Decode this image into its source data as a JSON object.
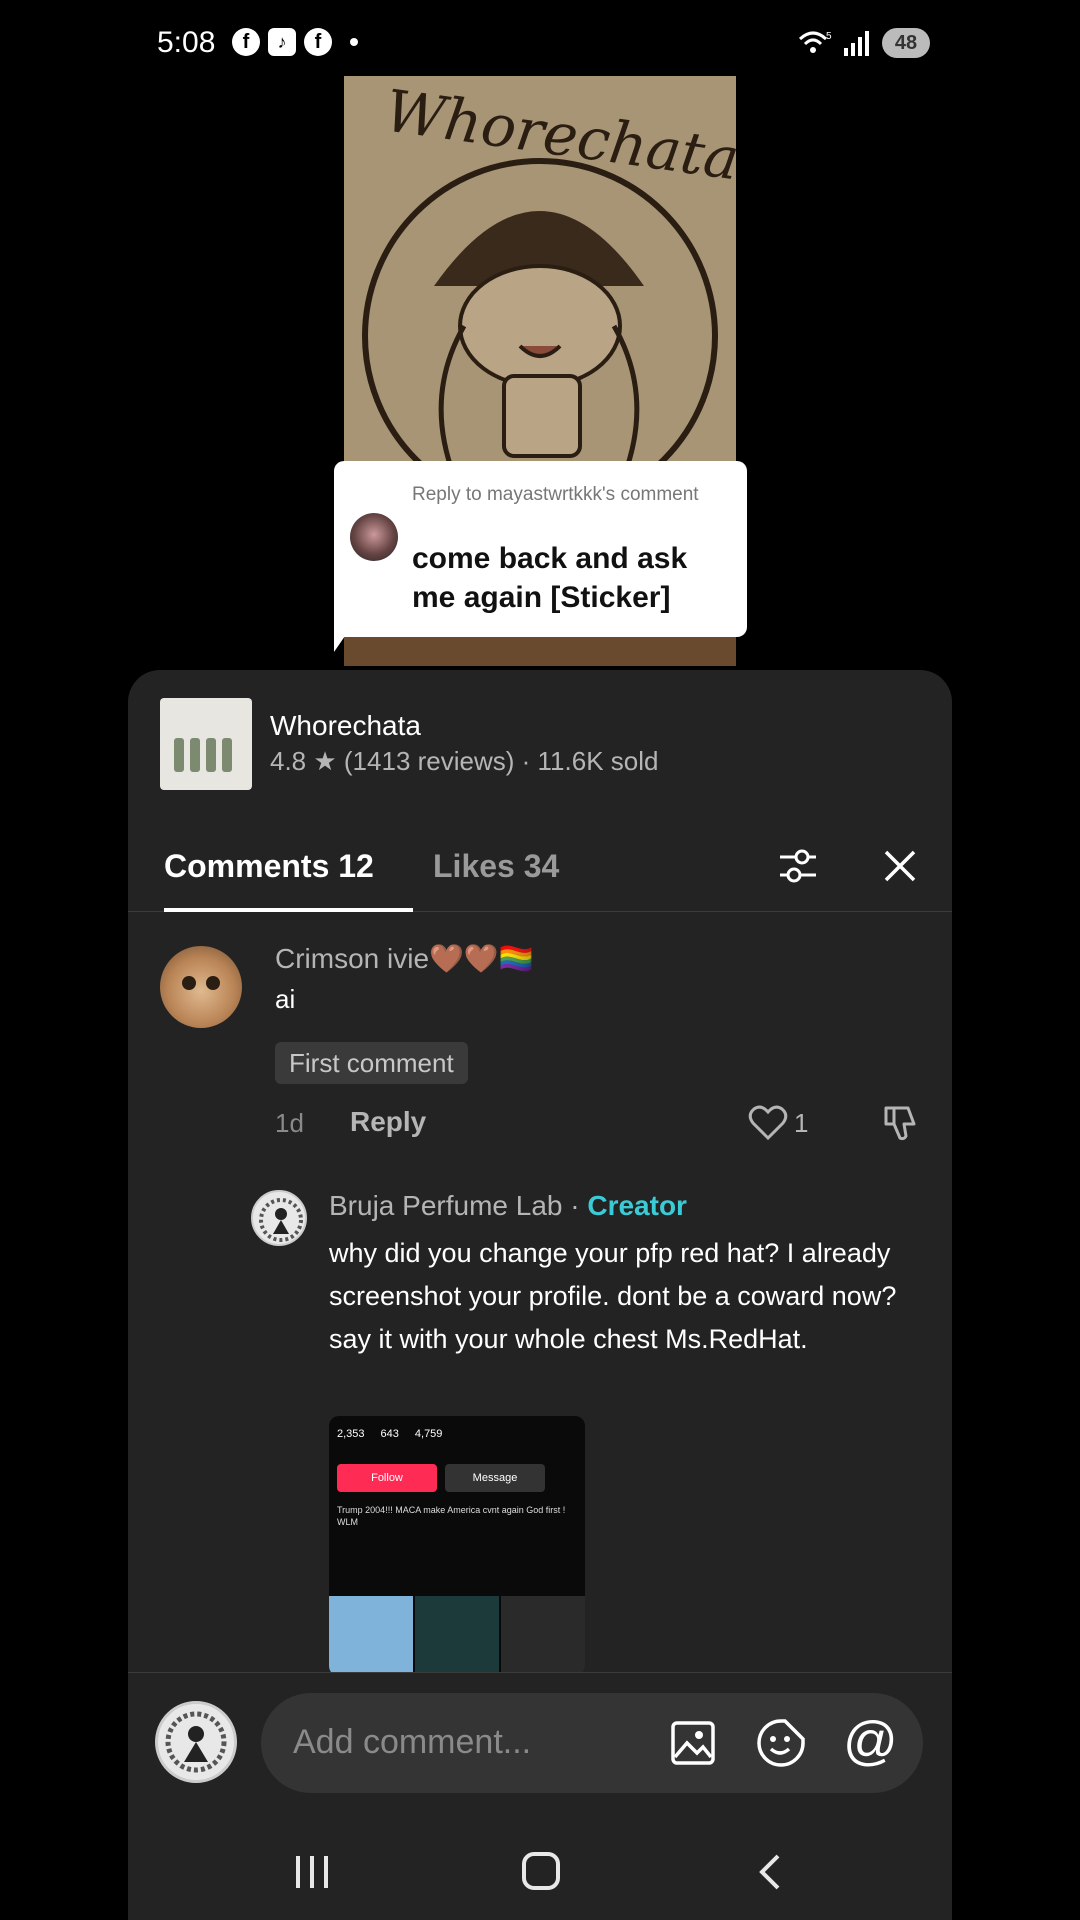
{
  "status_bar": {
    "time": "5:08",
    "notification_icons": [
      "facebook-icon",
      "tiktok-shop-icon",
      "facebook-icon"
    ],
    "wifi_badge": "5",
    "battery": "48"
  },
  "video": {
    "overlay_title": "Whorechata"
  },
  "reply_bubble": {
    "label": "Reply to mayastwrtkkk's comment",
    "text": "come back and ask me again [Sticker]"
  },
  "product": {
    "name": "Whorechata",
    "meta": "4.8 ★ (1413 reviews) · 11.6K sold"
  },
  "tabs": {
    "comments": "Comments 12",
    "likes": "Likes 34"
  },
  "comment": {
    "user": "Crimson ivie🤎🤎🏳️‍🌈",
    "text": "ai",
    "badge": "First comment",
    "time": "1d",
    "reply_label": "Reply",
    "like_count": "1"
  },
  "reply": {
    "user": "Bruja Perfume Lab",
    "separator": " · ",
    "creator_tag": "Creator",
    "text": "why did you change your pfp red hat? I already screenshot your profile. dont be a coward now? say it with your whole chest Ms.RedHat.",
    "image": {
      "stats": [
        "2,353",
        "643",
        "4,759"
      ],
      "follow": "Follow",
      "message": "Message",
      "bio": "Trump 2004!!! MACA make America cvnt again God first ! WLM"
    }
  },
  "composer": {
    "placeholder": "Add comment..."
  },
  "colors": {
    "sheet_bg": "#232323",
    "creator_accent": "#3bcbd6",
    "follow_red": "#fe2c55"
  }
}
